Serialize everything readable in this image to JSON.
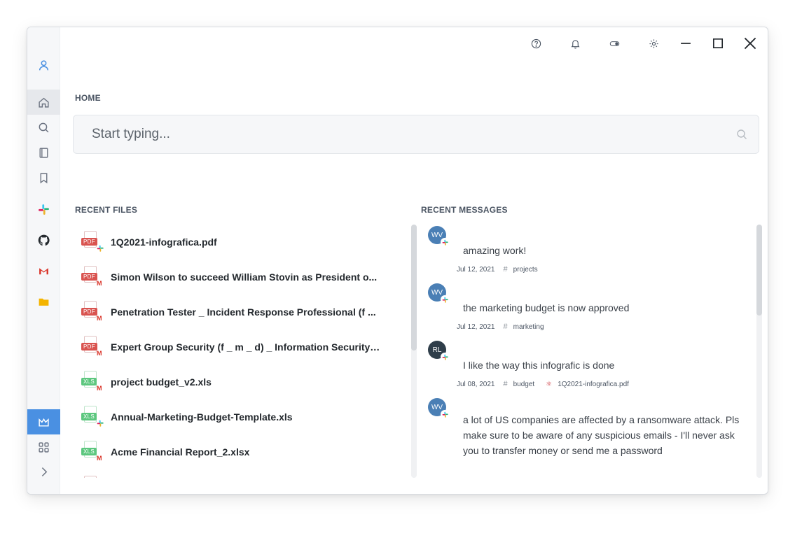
{
  "sidebar": {
    "items": [
      {
        "name": "profile-icon"
      },
      {
        "name": "home-icon"
      },
      {
        "name": "search-icon"
      },
      {
        "name": "book-icon"
      },
      {
        "name": "bookmark-icon"
      },
      {
        "name": "slack-icon"
      },
      {
        "name": "github-icon"
      },
      {
        "name": "gmail-icon"
      },
      {
        "name": "folder-icon"
      },
      {
        "name": "crown-icon"
      },
      {
        "name": "apps-icon"
      },
      {
        "name": "chevron-right-icon"
      }
    ],
    "accent_color": "#4a90e2"
  },
  "titlebar": {
    "icons": [
      "help-icon",
      "bell-icon",
      "toggle-icon",
      "gear-icon"
    ],
    "controls": [
      "minimize-icon",
      "maximize-icon",
      "close-icon"
    ]
  },
  "home": {
    "title": "HOME",
    "search_placeholder": "Start typing..."
  },
  "recent_files": {
    "title": "RECENT FILES",
    "files": [
      {
        "type": "PDF",
        "source": "slack",
        "name": "1Q2021-infografica.pdf"
      },
      {
        "type": "PDF",
        "source": "gmail",
        "name": "Simon Wilson to succeed William Stovin as President o..."
      },
      {
        "type": "PDF",
        "source": "gmail",
        "name": "Penetration Tester _ Incident Response Professional (f ..."
      },
      {
        "type": "PDF",
        "source": "gmail",
        "name": "Expert Group Security (f _ m _ d) _ Information Security ..."
      },
      {
        "type": "XLS",
        "source": "gmail",
        "name": "project budget_v2.xls"
      },
      {
        "type": "XLS",
        "source": "slack",
        "name": "Annual-Marketing-Budget-Template.xls"
      },
      {
        "type": "XLS",
        "source": "gmail",
        "name": "Acme Financial Report_2.xlsx"
      }
    ]
  },
  "recent_messages": {
    "title": "RECENT MESSAGES",
    "messages": [
      {
        "initials": "WV",
        "avatar_color": "#4a7fb5",
        "text": "amazing work!",
        "date": "Jul 12, 2021",
        "channel": "projects",
        "attachment": ""
      },
      {
        "initials": "WV",
        "avatar_color": "#4a7fb5",
        "text": "the marketing budget is now approved",
        "date": "Jul 12, 2021",
        "channel": "marketing",
        "attachment": ""
      },
      {
        "initials": "RL",
        "avatar_color": "#2f3e4a",
        "text": "I like the way this infografic is done",
        "date": "Jul 08, 2021",
        "channel": "budget",
        "attachment": "1Q2021-infografica.pdf"
      },
      {
        "initials": "WV",
        "avatar_color": "#4a7fb5",
        "text": "a lot of US companies are affected by a ransomware attack. Pls make sure to be aware of any suspicious emails - I'll never ask you to transfer money or send me a password",
        "date": "",
        "channel": "",
        "attachment": ""
      }
    ]
  },
  "colors": {
    "pdf": "#d9534f",
    "xls": "#5cc77e",
    "gmail": "#d93025",
    "slack_blue": "#36c5f0",
    "slack_green": "#2eb67d",
    "slack_yellow": "#ecb22e",
    "slack_red": "#e01e5a"
  }
}
